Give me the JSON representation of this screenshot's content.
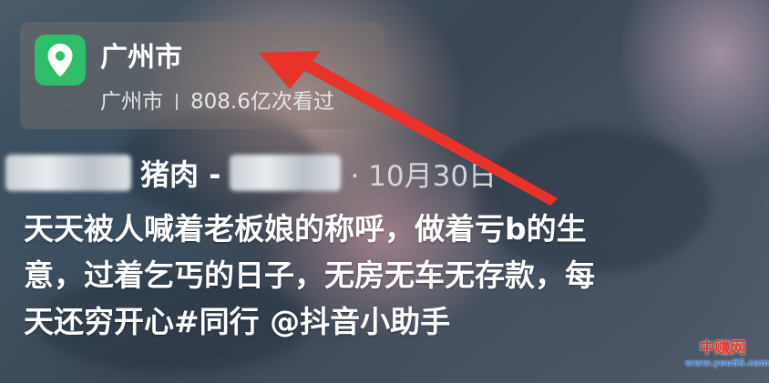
{
  "location": {
    "title": "广州市",
    "city": "广州市",
    "views": "808.6亿次看过",
    "icon": "location-pin-icon",
    "icon_color": "#2fbf6a"
  },
  "post": {
    "author_suffix": "猪肉 -",
    "date": "· 10月30日",
    "caption_lines": [
      "天天被人喊着老板娘的称呼，做着亏b的生",
      "意，过着乞丐的日子，无房无车无存款，每",
      "天还穷开心#同行 @抖音小助手"
    ]
  },
  "annotation": {
    "arrow_color": "#e8322a"
  },
  "watermark": {
    "main": "中赚网",
    "url": "www.you85.com"
  }
}
